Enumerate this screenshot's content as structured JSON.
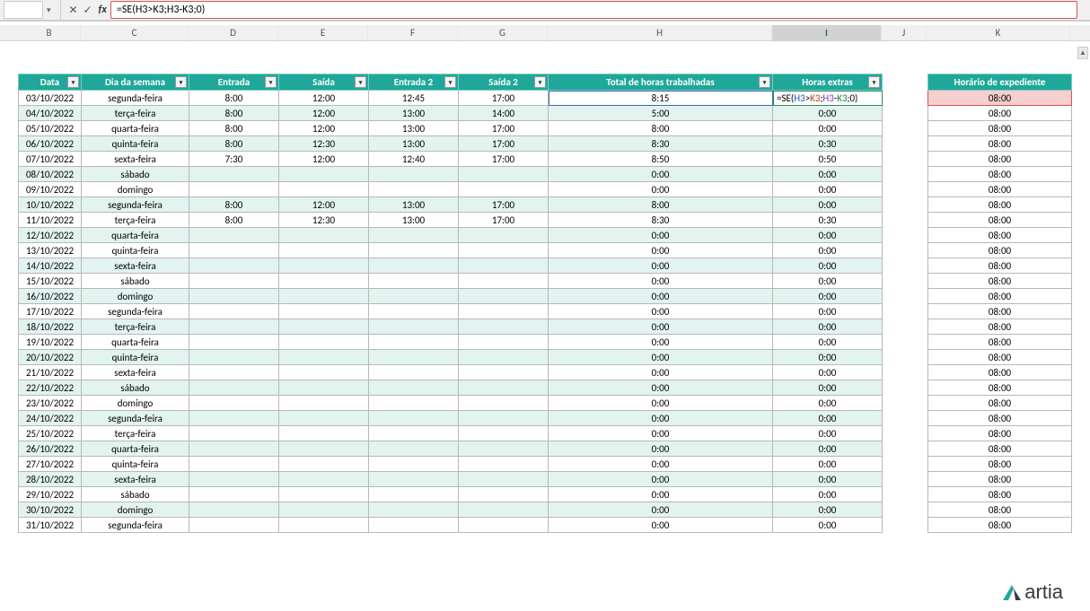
{
  "formula_bar": {
    "cancel": "✕",
    "confirm": "✓",
    "fx": "fx",
    "formula": "=SE(H3>K3;H3-K3;0)"
  },
  "columns": [
    "B",
    "C",
    "D",
    "E",
    "F",
    "G",
    "H",
    "I",
    "J",
    "K"
  ],
  "headers": {
    "data": "Data",
    "dia": "Dia da semana",
    "entrada": "Entrada",
    "saida": "Saída",
    "entrada2": "Entrada 2",
    "saida2": "Saída 2",
    "total": "Total de horas trabalhadas",
    "extras": "Horas extras",
    "expediente": "Horário de expediente"
  },
  "cell_formula": {
    "lead": "=SE(",
    "r1": "H3",
    "gt": ">",
    "r2": "K3",
    "sep1": ";",
    "r3": "H3",
    "minus": "-",
    "r4": "K3",
    "tail": ";0)"
  },
  "rows": [
    {
      "data": "03/10/2022",
      "dia": "segunda-feira",
      "e": "8:00",
      "s": "12:00",
      "e2": "12:45",
      "s2": "17:00",
      "tot": "8:15",
      "ext": "",
      "exp": "08:00",
      "stripe": false,
      "active": true
    },
    {
      "data": "04/10/2022",
      "dia": "terça-feira",
      "e": "8:00",
      "s": "12:00",
      "e2": "13:00",
      "s2": "14:00",
      "tot": "5:00",
      "ext": "0:00",
      "exp": "08:00",
      "stripe": true
    },
    {
      "data": "05/10/2022",
      "dia": "quarta-feira",
      "e": "8:00",
      "s": "12:00",
      "e2": "13:00",
      "s2": "17:00",
      "tot": "8:00",
      "ext": "0:00",
      "exp": "08:00",
      "stripe": false
    },
    {
      "data": "06/10/2022",
      "dia": "quinta-feira",
      "e": "8:00",
      "s": "12:30",
      "e2": "13:00",
      "s2": "17:00",
      "tot": "8:30",
      "ext": "0:30",
      "exp": "08:00",
      "stripe": true
    },
    {
      "data": "07/10/2022",
      "dia": "sexta-feira",
      "e": "7:30",
      "s": "12:00",
      "e2": "12:40",
      "s2": "17:00",
      "tot": "8:50",
      "ext": "0:50",
      "exp": "08:00",
      "stripe": false
    },
    {
      "data": "08/10/2022",
      "dia": "sábado",
      "e": "",
      "s": "",
      "e2": "",
      "s2": "",
      "tot": "0:00",
      "ext": "0:00",
      "exp": "08:00",
      "stripe": true
    },
    {
      "data": "09/10/2022",
      "dia": "domingo",
      "e": "",
      "s": "",
      "e2": "",
      "s2": "",
      "tot": "0:00",
      "ext": "0:00",
      "exp": "08:00",
      "stripe": false
    },
    {
      "data": "10/10/2022",
      "dia": "segunda-feira",
      "e": "8:00",
      "s": "12:00",
      "e2": "13:00",
      "s2": "17:00",
      "tot": "8:00",
      "ext": "0:00",
      "exp": "08:00",
      "stripe": true
    },
    {
      "data": "11/10/2022",
      "dia": "terça-feira",
      "e": "8:00",
      "s": "12:30",
      "e2": "13:00",
      "s2": "17:00",
      "tot": "8:30",
      "ext": "0:30",
      "exp": "08:00",
      "stripe": false
    },
    {
      "data": "12/10/2022",
      "dia": "quarta-feira",
      "e": "",
      "s": "",
      "e2": "",
      "s2": "",
      "tot": "0:00",
      "ext": "0:00",
      "exp": "08:00",
      "stripe": true
    },
    {
      "data": "13/10/2022",
      "dia": "quinta-feira",
      "e": "",
      "s": "",
      "e2": "",
      "s2": "",
      "tot": "0:00",
      "ext": "0:00",
      "exp": "08:00",
      "stripe": false
    },
    {
      "data": "14/10/2022",
      "dia": "sexta-feira",
      "e": "",
      "s": "",
      "e2": "",
      "s2": "",
      "tot": "0:00",
      "ext": "0:00",
      "exp": "08:00",
      "stripe": true
    },
    {
      "data": "15/10/2022",
      "dia": "sábado",
      "e": "",
      "s": "",
      "e2": "",
      "s2": "",
      "tot": "0:00",
      "ext": "0:00",
      "exp": "08:00",
      "stripe": false
    },
    {
      "data": "16/10/2022",
      "dia": "domingo",
      "e": "",
      "s": "",
      "e2": "",
      "s2": "",
      "tot": "0:00",
      "ext": "0:00",
      "exp": "08:00",
      "stripe": true
    },
    {
      "data": "17/10/2022",
      "dia": "segunda-feira",
      "e": "",
      "s": "",
      "e2": "",
      "s2": "",
      "tot": "0:00",
      "ext": "0:00",
      "exp": "08:00",
      "stripe": false
    },
    {
      "data": "18/10/2022",
      "dia": "terça-feira",
      "e": "",
      "s": "",
      "e2": "",
      "s2": "",
      "tot": "0:00",
      "ext": "0:00",
      "exp": "08:00",
      "stripe": true
    },
    {
      "data": "19/10/2022",
      "dia": "quarta-feira",
      "e": "",
      "s": "",
      "e2": "",
      "s2": "",
      "tot": "0:00",
      "ext": "0:00",
      "exp": "08:00",
      "stripe": false
    },
    {
      "data": "20/10/2022",
      "dia": "quinta-feira",
      "e": "",
      "s": "",
      "e2": "",
      "s2": "",
      "tot": "0:00",
      "ext": "0:00",
      "exp": "08:00",
      "stripe": true
    },
    {
      "data": "21/10/2022",
      "dia": "sexta-feira",
      "e": "",
      "s": "",
      "e2": "",
      "s2": "",
      "tot": "0:00",
      "ext": "0:00",
      "exp": "08:00",
      "stripe": false
    },
    {
      "data": "22/10/2022",
      "dia": "sábado",
      "e": "",
      "s": "",
      "e2": "",
      "s2": "",
      "tot": "0:00",
      "ext": "0:00",
      "exp": "08:00",
      "stripe": true
    },
    {
      "data": "23/10/2022",
      "dia": "domingo",
      "e": "",
      "s": "",
      "e2": "",
      "s2": "",
      "tot": "0:00",
      "ext": "0:00",
      "exp": "08:00",
      "stripe": false
    },
    {
      "data": "24/10/2022",
      "dia": "segunda-feira",
      "e": "",
      "s": "",
      "e2": "",
      "s2": "",
      "tot": "0:00",
      "ext": "0:00",
      "exp": "08:00",
      "stripe": true
    },
    {
      "data": "25/10/2022",
      "dia": "terça-feira",
      "e": "",
      "s": "",
      "e2": "",
      "s2": "",
      "tot": "0:00",
      "ext": "0:00",
      "exp": "08:00",
      "stripe": false
    },
    {
      "data": "26/10/2022",
      "dia": "quarta-feira",
      "e": "",
      "s": "",
      "e2": "",
      "s2": "",
      "tot": "0:00",
      "ext": "0:00",
      "exp": "08:00",
      "stripe": true
    },
    {
      "data": "27/10/2022",
      "dia": "quinta-feira",
      "e": "",
      "s": "",
      "e2": "",
      "s2": "",
      "tot": "0:00",
      "ext": "0:00",
      "exp": "08:00",
      "stripe": false
    },
    {
      "data": "28/10/2022",
      "dia": "sexta-feira",
      "e": "",
      "s": "",
      "e2": "",
      "s2": "",
      "tot": "0:00",
      "ext": "0:00",
      "exp": "08:00",
      "stripe": true
    },
    {
      "data": "29/10/2022",
      "dia": "sábado",
      "e": "",
      "s": "",
      "e2": "",
      "s2": "",
      "tot": "0:00",
      "ext": "0:00",
      "exp": "08:00",
      "stripe": false
    },
    {
      "data": "30/10/2022",
      "dia": "domingo",
      "e": "",
      "s": "",
      "e2": "",
      "s2": "",
      "tot": "0:00",
      "ext": "0:00",
      "exp": "08:00",
      "stripe": true
    },
    {
      "data": "31/10/2022",
      "dia": "segunda-feira",
      "e": "",
      "s": "",
      "e2": "",
      "s2": "",
      "tot": "0:00",
      "ext": "0:00",
      "exp": "08:00",
      "stripe": false
    }
  ],
  "logo_text": "artia"
}
